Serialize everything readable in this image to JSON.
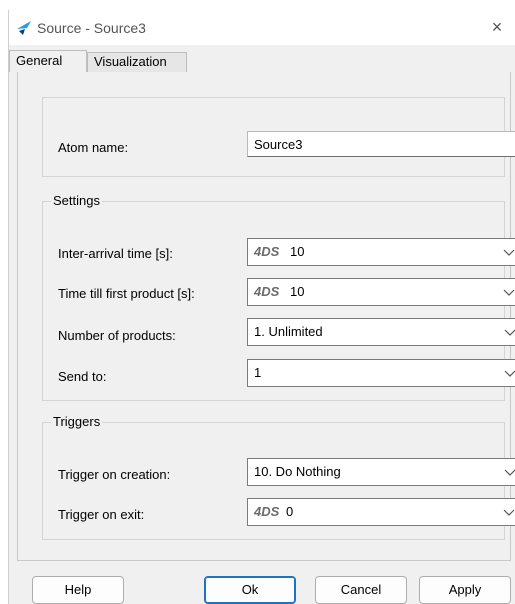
{
  "window": {
    "title": "Source - Source3",
    "close_glyph": "×"
  },
  "tabs": [
    {
      "label": "General",
      "active": true
    },
    {
      "label": "Visualization",
      "active": false
    }
  ],
  "atom": {
    "label": "Atom name:",
    "value": "Source3"
  },
  "settings": {
    "title": "Settings",
    "inter_arrival": {
      "label": "Inter-arrival time [s]:",
      "prefix": "4DS",
      "value": "10"
    },
    "first_product": {
      "label": "Time till first product [s]:",
      "prefix": "4DS",
      "value": "10"
    },
    "num_products": {
      "label": "Number of products:",
      "value": "1. Unlimited"
    },
    "send_to": {
      "label": "Send to:",
      "value": "1"
    }
  },
  "triggers": {
    "title": "Triggers",
    "on_creation": {
      "label": "Trigger on creation:",
      "value": "10. Do Nothing"
    },
    "on_exit": {
      "label": "Trigger on exit:",
      "prefix": "4DS",
      "value": "0"
    }
  },
  "buttons": {
    "help": "Help",
    "ok": "Ok",
    "cancel": "Cancel",
    "apply": "Apply"
  },
  "colors": {
    "window_bg": "#f0f0f0",
    "accent": "#1a73c8",
    "icon_blue": "#1d9bf0"
  },
  "icons": [
    "app-logo-icon",
    "close-icon",
    "chevron-down-icon"
  ]
}
